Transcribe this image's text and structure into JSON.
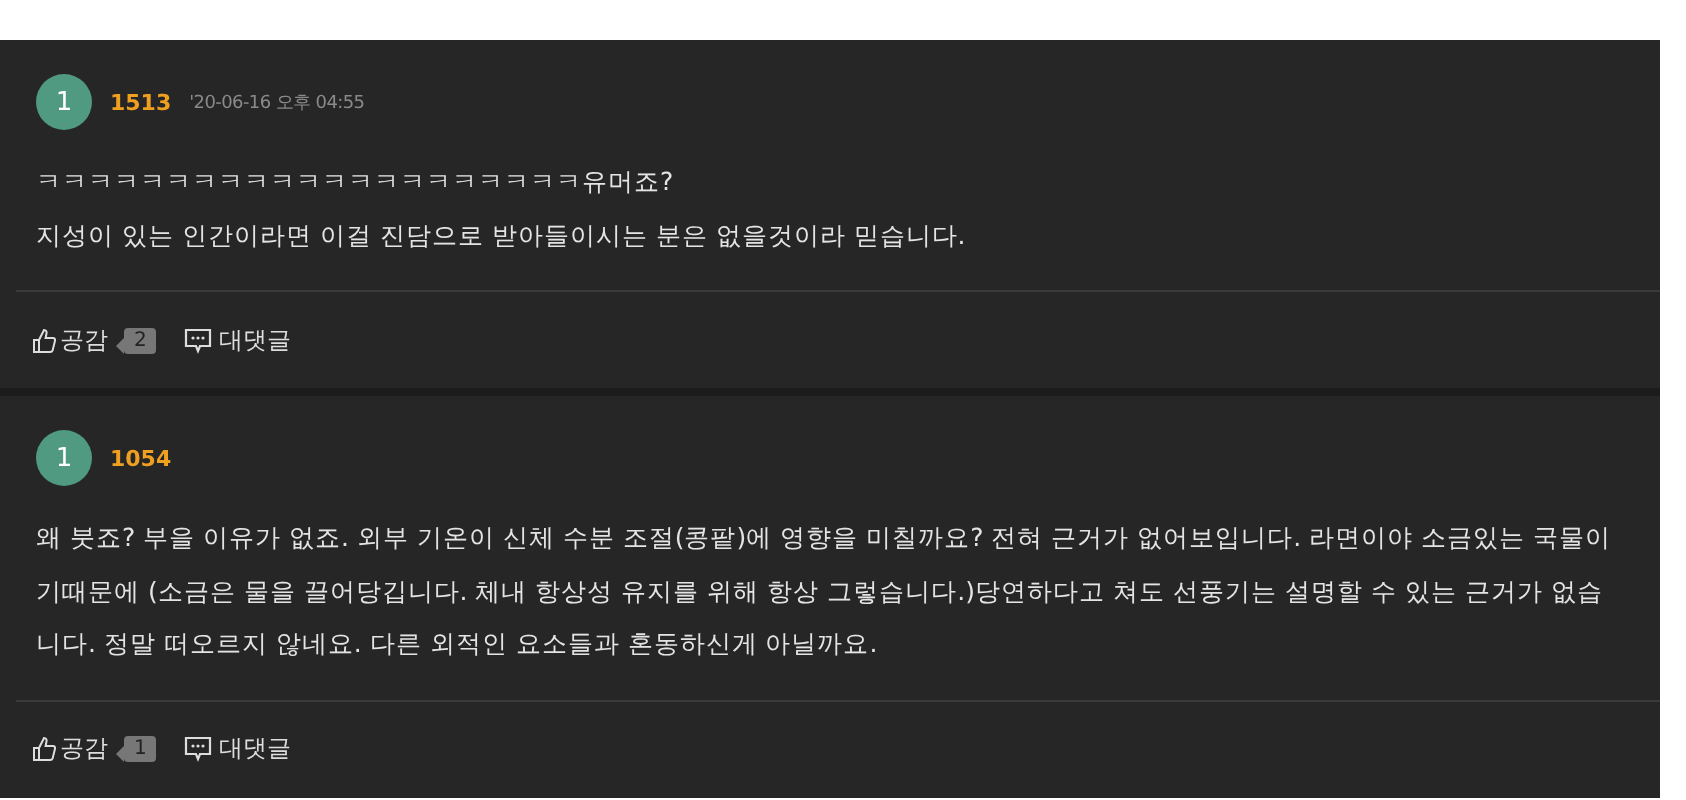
{
  "comments": [
    {
      "avatar": "1",
      "author": "1513",
      "date": "'20-06-16 오후 04:55",
      "lines": [
        "ㅋㅋㅋㅋㅋㅋㅋㅋㅋㅋㅋㅋㅋㅋㅋㅋㅋㅋㅋㅋㅋ유머죠?",
        "지성이 있는 인간이라면 이걸 진담으로 받아들이시는 분은 없을것이라 믿습니다."
      ],
      "like_label": "공감",
      "like_count": "2",
      "reply_label": "대댓글"
    },
    {
      "avatar": "1",
      "author": "1054",
      "lines": [
        "왜 붓죠? 부을 이유가 없죠. 외부 기온이 신체 수분 조절(콩팥)에 영향을 미칠까요? 전혀 근거가 없어보입니다. 라면이야 소금있는 국물이기때문에 (소금은 물을 끌어당깁니다. 체내 항상성 유지를 위해 항상 그렇습니다.)당연하다고 쳐도 선풍기는 설명할 수 있는 근거가 없습니다. 정말 떠오르지 않네요. 다른 외적인 요소들과 혼동하신게 아닐까요."
      ],
      "like_label": "공감",
      "like_count": "1",
      "reply_label": "대댓글"
    }
  ]
}
